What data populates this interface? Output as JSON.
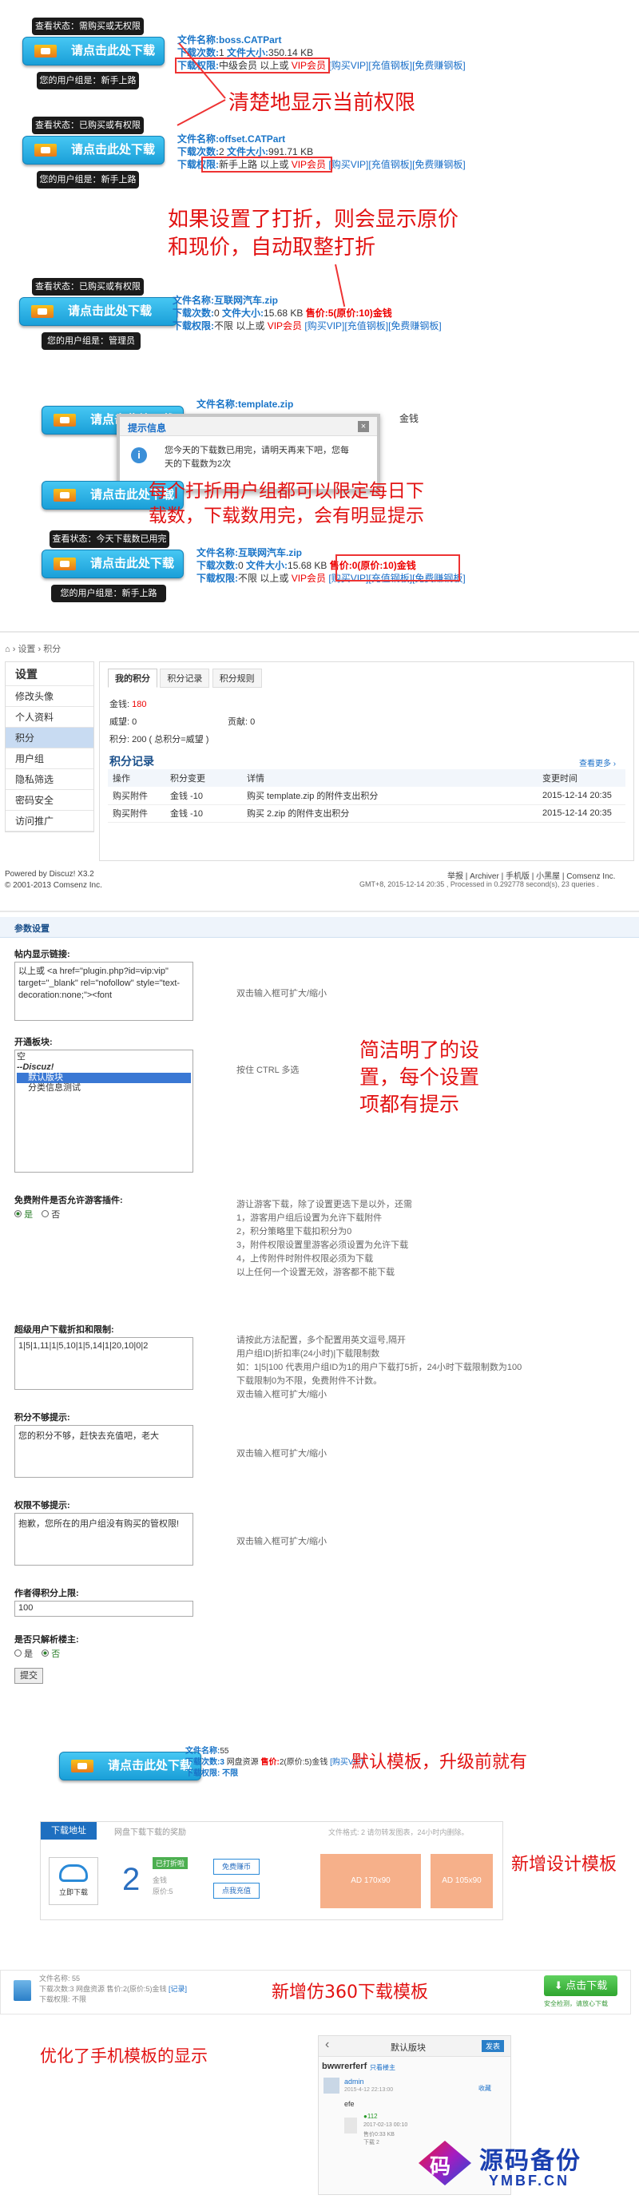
{
  "annotations": {
    "a1": "清楚地显示当前权限",
    "a2_l1": "如果设置了打折，则会显示原价",
    "a2_l2": "和现价，自动取整打折",
    "a3_l1": "每个打折用户组都可以限定每日下",
    "a3_l2": "载数，下载数用完，会有明显提示",
    "a4_l1": "简洁明了的设",
    "a4_l2": "置，每个设置",
    "a4_l3": "项都有提示",
    "a5": "默认模板，升级前就有",
    "a6": "新增设计模板",
    "a7": "新增仿360下载模板",
    "a8": "优化了手机模板的显示"
  },
  "download_label": "请点击此处下载",
  "blocks": [
    {
      "status": "查看状态：需购买或无权限",
      "group": "您的用户组是：新手上路",
      "fname_k": "文件名称:",
      "fname": "boss.CATPart",
      "cnt_k": "下载次数:",
      "cnt": "1",
      "size_k": "文件大小:",
      "size": "350.14 KB",
      "perm_k": "下载权限:",
      "perm": "中级会员 以上或",
      "vip": "VIP会员",
      "l1": "[购买VIP]",
      "l2": "[充值钢板]",
      "l3": "[免费赚钢板]"
    },
    {
      "status": "查看状态：已购买或有权限",
      "group": "您的用户组是：新手上路",
      "fname_k": "文件名称:",
      "fname": "offset.CATPart",
      "cnt_k": "下载次数:",
      "cnt": "2",
      "size_k": "文件大小:",
      "size": "991.71 KB",
      "perm_k": "下载权限:",
      "perm": "新手上路 以上或",
      "vip": "VIP会员",
      "l1": "[购买VIP]",
      "l2": "[充值钢板]",
      "l3": "[免费赚钢板]"
    },
    {
      "status": "查看状态：已购买或有权限",
      "group": "您的用户组是：管理员",
      "fname_k": "文件名称:",
      "fname": "互联网汽车.zip",
      "cnt_k": "下载次数:",
      "cnt": "0",
      "size_k": "文件大小:",
      "size": "15.68 KB",
      "price_k": "售价:",
      "price": "5(原价:10)金钱",
      "perm_k": "下载权限:",
      "perm": "不限 以上或",
      "vip": "VIP会员",
      "l1": "[购买VIP]",
      "l2": "[充值钢板]",
      "l3": "[免费赚钢板]"
    }
  ],
  "popup": {
    "fname_k": "文件名称:",
    "fname": "template.zip",
    "tail": "金钱",
    "title": "提示信息",
    "msg": "您今天的下载数已用完，请明天再来下吧，您每天的下载数为2次"
  },
  "block5": {
    "status": "查看状态：今天下载数已用完",
    "group": "您的用户组是：新手上路",
    "fname_k": "文件名称:",
    "fname": "互联网汽车.zip",
    "cnt_k": "下载次数:",
    "cnt": "0",
    "size_k": "文件大小:",
    "size": "15.68 KB",
    "price_k": "售价:",
    "price": "0(原价:10)金钱",
    "perm_k": "下载权限:",
    "perm": "不限 以上或",
    "vip": "VIP会员",
    "l1": "[购买VIP]",
    "l2": "[充值钢板]",
    "l3": "[免费赚钢板]"
  },
  "uc": {
    "crumb1": "设置",
    "crumb2": "积分",
    "side_title": "设置",
    "side": [
      "修改头像",
      "个人资料",
      "积分",
      "用户组",
      "隐私筛选",
      "密码安全",
      "访问推广"
    ],
    "tabs": [
      "我的积分",
      "积分记录",
      "积分规则"
    ],
    "money_k": "金钱:",
    "money": "180",
    "weiwang": "威望: 0",
    "gongxian": "贡献: 0",
    "score": "积分: 200 ( 总积分=威望 )",
    "log_title": "积分记录",
    "more": "查看更多 ›",
    "cols": [
      "操作",
      "积分变更",
      "详情",
      "变更时间"
    ],
    "rows": [
      [
        "购买附件",
        "金钱 -10",
        "购买 template.zip 的附件支出积分",
        "2015-12-14 20:35"
      ],
      [
        "购买附件",
        "金钱 -10",
        "购买 2.zip 的附件支出积分",
        "2015-12-14 20:35"
      ]
    ],
    "footer_l1": "Powered by Discuz! X3.2",
    "footer_l2": "© 2001-2013 Comsenz Inc.",
    "footer_links": "举报 | Archiver | 手机版 | 小黑屋 | Comsenz Inc.",
    "footer_gmt": "GMT+8, 2015-12-14 20:35 , Processed in 0.292778 second(s), 23 queries ."
  },
  "settings": {
    "header": "参数设置",
    "f1_label": "帖内显示链接:",
    "f1_value": "以上或 <a href=\"plugin.php?id=vip:vip\" target=\"_blank\" rel=\"nofollow\" style=\"text-decoration:none;\"><font",
    "f1_hint": "双击输入框可扩大/缩小",
    "f2_label": "开通板块:",
    "f2_opts": [
      "空",
      "--Discuz!",
      "  默认版块",
      "  分类信息测试"
    ],
    "f2_hint": "按住 CTRL 多选",
    "f3_label": "免费附件是否允许游客插件:",
    "f3_yes": "是",
    "f3_no": "否",
    "f3_hint": [
      "游让游客下载，除了设置更选下是以外，还需",
      "1，游客用户组后设置为允许下载附件",
      "2，积分策略里下载扣积分为0",
      "3，附件权限设置里游客必须设置为允许下载",
      "4，上传附件时附件权限必须为下载",
      "以上任何一个设置无效，游客都不能下载"
    ],
    "f4_label": "超级用户下载折扣和限制:",
    "f4_value": "1|5|1,11|1|5,10|1|5,14|1|20,10|0|2",
    "f4_hint": [
      "请按此方法配置，多个配置用英文逗号,隔开",
      "用户组ID|折扣率(24小时)|下载限制数",
      "如：1|5|100 代表用户组ID为1的用户下载打5折，24小时下载限制数为100",
      "下载限制0为不限，免费附件不计数。",
      "双击输入框可扩大/缩小"
    ],
    "f5_label": "积分不够提示:",
    "f5_value": "您的积分不够，赶快去充值吧，老大",
    "f5_hint": "双击输入框可扩大/缩小",
    "f6_label": "权限不够提示:",
    "f6_value": "抱歉，您所在的用户组没有购买的管权限!",
    "f6_hint": "双击输入框可扩大/缩小",
    "f7_label": "作者得积分上限:",
    "f7_value": "100",
    "f8_label": "是否只解析楼主:",
    "f8_yes": "是",
    "f8_no": "否",
    "submit": "提交"
  },
  "tpl_default": {
    "fname_k": "文件名称:",
    "fname": "55",
    "cnt": "下载次数:3",
    "net": "网盘资源",
    "price_k": "售价:",
    "price": "2(原价:5)金钱",
    "l1": "[购买VIP]",
    "perm": "下载权限: 不限"
  },
  "tpl_design": {
    "tab1": "下载地址",
    "tab2": "网盘下载下载的奖励",
    "note": "文件格式: 2 请勿转发图表，24小时内删除。",
    "local": "立即下载",
    "count": "2",
    "badge": "已打折啦",
    "gold": "金钱",
    "orig": "原价:5",
    "free": "免费赚币",
    "recharge": "点我充值",
    "ad1": "AD 170x90",
    "ad2": "AD 105x90"
  },
  "tpl_360": {
    "l1": "文件名称: 55",
    "l2": "下载次数:3 网盘资源 售价:2(原价:5)金钱",
    "l3": "[记录]",
    "l4": "下载权限: 不限",
    "btn": "点击下载",
    "safe": "安全检测，请放心下载"
  },
  "mobile": {
    "title": "默认版块",
    "back": "‹",
    "btn": "发表",
    "user": "bwwrerferf",
    "tag": "只看楼主",
    "admin": "admin",
    "date": "2015-4-12 22:13:00",
    "reply": "收藏",
    "text": "efe",
    "sub": "●112",
    "p1": "2017-02-13 00:10",
    "p2": "售价0:33 KB",
    "p3": "下载 2"
  },
  "logo": {
    "mark": "码",
    "text": "源码备份",
    "url": "YMBF.CN"
  }
}
